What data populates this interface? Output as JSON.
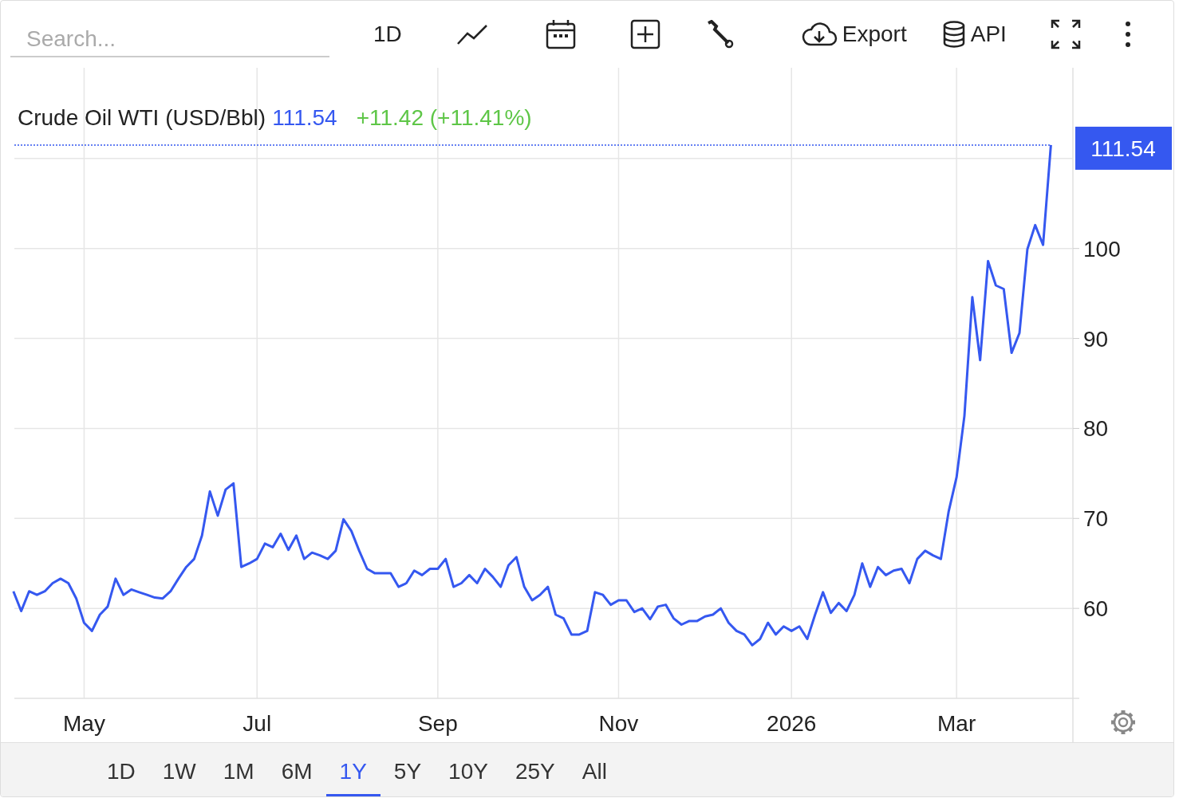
{
  "toolbar": {
    "search": {
      "placeholder": "Search..."
    },
    "interval": "1D",
    "export": "Export",
    "api": "API"
  },
  "chart": {
    "legend": {
      "price": "111.54",
      "change": "+11.42 (+11.41%)"
    },
    "price_tag": "111.54",
    "chart_data": {
      "type": "line",
      "grid": true,
      "ref_lines": [
        {
          "axis": "y",
          "value": 111.5
        }
      ],
      "ylim": [
        50,
        120
      ],
      "yticks": [
        60,
        70,
        80,
        90,
        100
      ],
      "categories": [
        null,
        null,
        null,
        null,
        null,
        null,
        null,
        null,
        null,
        "May",
        null,
        null,
        null,
        null,
        null,
        null,
        null,
        null,
        null,
        null,
        null,
        null,
        null,
        null,
        null,
        null,
        null,
        null,
        null,
        null,
        null,
        "Jul",
        null,
        null,
        null,
        null,
        null,
        null,
        null,
        null,
        null,
        null,
        null,
        null,
        null,
        null,
        null,
        null,
        null,
        null,
        null,
        null,
        null,
        null,
        "Sep",
        null,
        null,
        null,
        null,
        null,
        null,
        null,
        null,
        null,
        null,
        null,
        null,
        null,
        null,
        null,
        null,
        null,
        null,
        null,
        null,
        null,
        null,
        "Nov",
        null,
        null,
        null,
        null,
        null,
        null,
        null,
        null,
        null,
        null,
        null,
        null,
        null,
        null,
        null,
        null,
        null,
        null,
        null,
        null,
        null,
        "2026",
        null,
        null,
        null,
        null,
        null,
        null,
        null,
        null,
        null,
        null,
        null,
        null,
        null,
        null,
        null,
        null,
        null,
        null,
        null,
        null,
        "Mar",
        null,
        null,
        null,
        null,
        null,
        null,
        null,
        null,
        null,
        null,
        null,
        null
      ],
      "series": [
        {
          "name": "Crude Oil WTI (USD/Bbl)",
          "color": "#3558f0",
          "values": [
            61.9,
            59.7,
            61.9,
            61.5,
            61.9,
            62.8,
            63.3,
            62.8,
            61.1,
            58.4,
            57.5,
            59.3,
            60.2,
            63.3,
            61.5,
            62.1,
            61.8,
            61.5,
            61.2,
            61.1,
            61.9,
            63.3,
            64.6,
            65.5,
            68.1,
            73.0,
            70.3,
            73.2,
            73.9,
            64.6,
            65.0,
            65.5,
            67.2,
            66.8,
            68.3,
            66.5,
            68.1,
            65.5,
            66.2,
            65.9,
            65.5,
            66.4,
            69.9,
            68.6,
            66.4,
            64.4,
            63.9,
            63.9,
            63.9,
            62.4,
            62.8,
            64.2,
            63.7,
            64.4,
            64.4,
            65.5,
            62.4,
            62.8,
            63.7,
            62.8,
            64.4,
            63.5,
            62.4,
            64.8,
            65.7,
            62.4,
            60.9,
            61.5,
            62.4,
            59.3,
            58.9,
            57.1,
            57.1,
            57.5,
            61.8,
            61.5,
            60.4,
            60.9,
            60.9,
            59.6,
            60.0,
            58.8,
            60.2,
            60.4,
            58.9,
            58.2,
            58.6,
            58.6,
            59.1,
            59.3,
            60.0,
            58.4,
            57.5,
            57.1,
            55.9,
            56.6,
            58.4,
            57.1,
            58.0,
            57.5,
            58.0,
            56.6,
            59.3,
            61.8,
            59.5,
            60.6,
            59.7,
            61.5,
            65.0,
            62.4,
            64.6,
            63.7,
            64.2,
            64.4,
            62.8,
            65.5,
            66.4,
            65.9,
            65.5,
            70.8,
            74.6,
            81.4,
            94.6,
            87.6,
            98.6,
            95.9,
            95.5,
            88.4,
            90.6,
            99.9,
            102.6,
            100.4,
            111.5
          ]
        }
      ]
    }
  },
  "ranges": [
    {
      "label": "1D",
      "selected": false
    },
    {
      "label": "1W",
      "selected": false
    },
    {
      "label": "1M",
      "selected": false
    },
    {
      "label": "6M",
      "selected": false
    },
    {
      "label": "1Y",
      "selected": true
    },
    {
      "label": "5Y",
      "selected": false
    },
    {
      "label": "10Y",
      "selected": false
    },
    {
      "label": "25Y",
      "selected": false
    },
    {
      "label": "All",
      "selected": false
    }
  ]
}
